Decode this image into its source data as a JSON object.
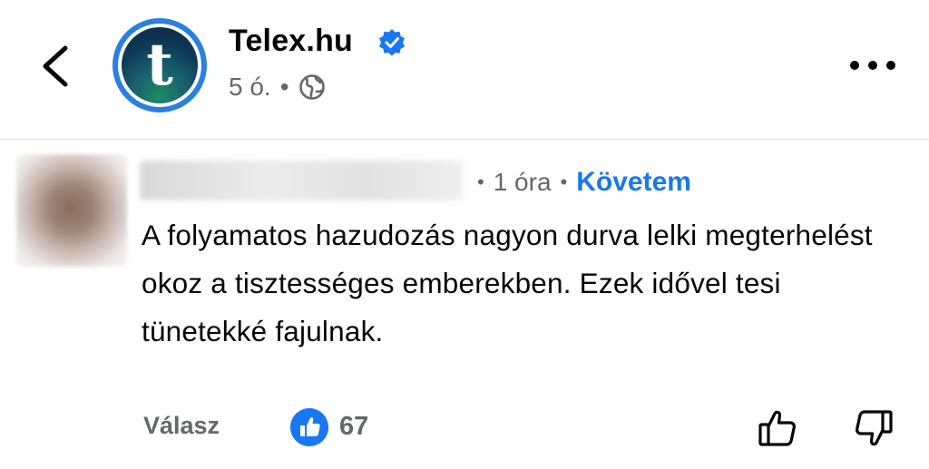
{
  "header": {
    "page_name": "Telex.hu",
    "logo_letter": "t",
    "time": "5 ó.",
    "separator": "•",
    "icons": {
      "back": "chevron-left-icon",
      "verified": "verified-badge-icon",
      "audience": "globe-icon",
      "more": "more-options-icon"
    }
  },
  "comment": {
    "time": "1 óra",
    "separator": "•",
    "follow_label": "Követem",
    "text": "A folyamatos hazudozás nagyon durva lelki megterhelést okoz a tisztességes emberekben. Ezek idővel tesi tünetekké fajulnak.",
    "reply_label": "Válasz",
    "like_count": "67",
    "icons": {
      "reaction": "like-reaction-icon",
      "upvote": "thumbs-up-icon",
      "downvote": "thumbs-down-icon"
    }
  },
  "colors": {
    "accent": "#1877f2",
    "secondary_text": "#65676b",
    "divider": "#dadde1"
  }
}
